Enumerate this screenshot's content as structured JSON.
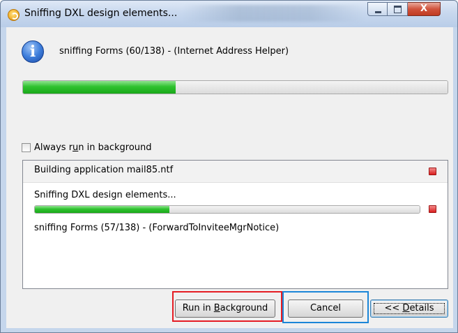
{
  "window": {
    "title": "Sniffing DXL design elements...",
    "close_glyph": "X"
  },
  "main": {
    "status": "sniffing Forms (60/138) - (Internet Address Helper)",
    "progress_fraction": 0.36
  },
  "options": {
    "always_background_pre": "Always r",
    "always_background_mnemonic": "u",
    "always_background_post": "n in background",
    "checked": false
  },
  "jobs": [
    {
      "label": "Building application mail85.ntf"
    },
    {
      "title": "Sniffing DXL design elements...",
      "status": "sniffing Forms (57/138) - (ForwardToInviteeMgrNotice)",
      "progress_fraction": 0.35
    }
  ],
  "buttons": {
    "run_in_background_pre": "Run in ",
    "run_in_background_mnemonic": "B",
    "run_in_background_post": "ackground",
    "cancel": "Cancel",
    "details_pre": "<< ",
    "details_mnemonic": "D",
    "details_post": "etails"
  },
  "highlights": {
    "red": "#e51c23",
    "blue": "#1b86d8"
  },
  "icons": {
    "app": "lotus-notes-icon",
    "info": "info-icon",
    "stop": "stop-icon"
  }
}
